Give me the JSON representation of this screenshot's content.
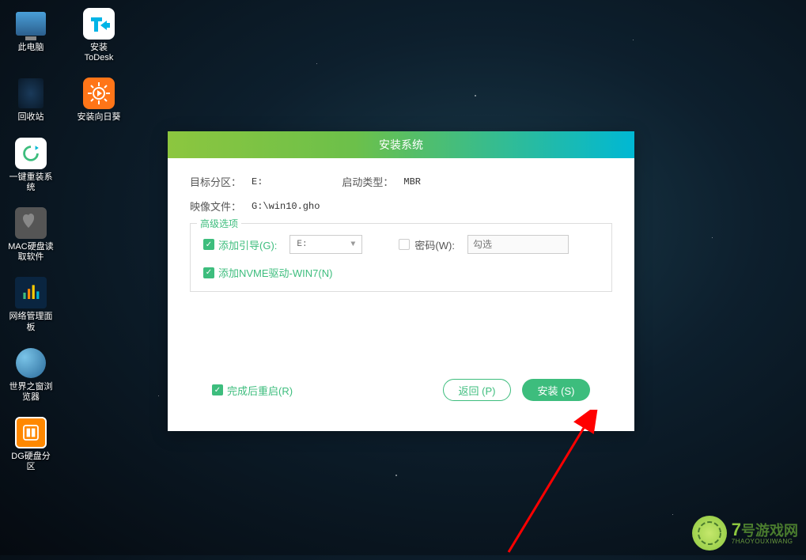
{
  "desktop": {
    "icons": [
      {
        "label": "此电脑"
      },
      {
        "label": "安装ToDesk"
      },
      {
        "label": "回收站"
      },
      {
        "label": "安装向日葵"
      },
      {
        "label": "一键重装系统"
      },
      {
        "label": "MAC硬盘读取软件"
      },
      {
        "label": "网络管理面板"
      },
      {
        "label": "世界之窗浏览器"
      },
      {
        "label": "DG硬盘分区"
      }
    ]
  },
  "modal": {
    "title": "安装系统",
    "target_partition_label": "目标分区：",
    "target_partition_value": "E:",
    "boot_type_label": "启动类型：",
    "boot_type_value": "MBR",
    "image_file_label": "映像文件：",
    "image_file_value": "G:\\win10.gho",
    "advanced": {
      "legend": "高级选项",
      "add_boot_label": "添加引导(G):",
      "add_boot_drive": "E:",
      "password_label": "密码(W):",
      "password_placeholder": "勾选",
      "nvme_label": "添加NVME驱动-WIN7(N)"
    },
    "restart_label": "完成后重启(R)",
    "back_button": "返回 (P)",
    "install_button": "安装 (S)"
  },
  "watermark": {
    "main": "号游戏网",
    "seven": "7",
    "sub": "7HAOYOUXIWANG"
  }
}
